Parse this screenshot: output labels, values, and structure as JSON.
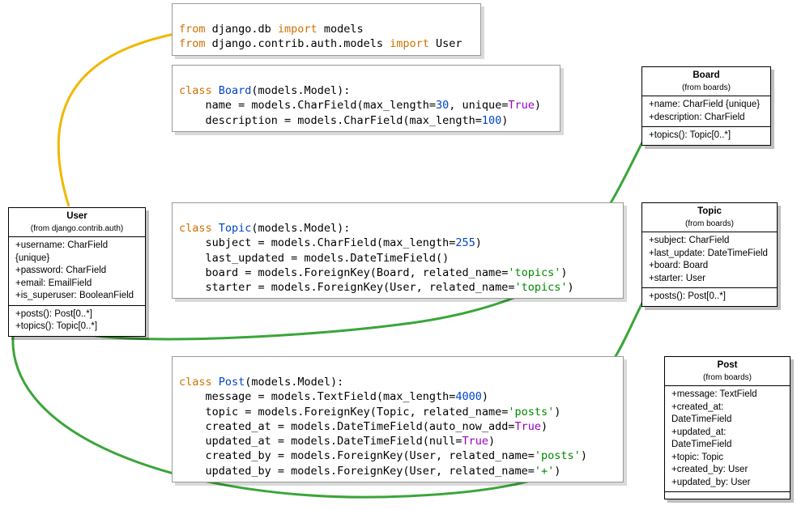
{
  "imports": {
    "line1": "from django.db import models",
    "line2": "from django.contrib.auth.models import User"
  },
  "code_board": {
    "line1": "class Board(models.Model):",
    "line2": "    name = models.CharField(max_length=30, unique=True)",
    "line3": "    description = models.CharField(max_length=100)"
  },
  "code_topic": {
    "line1": "class Topic(models.Model):",
    "line2": "    subject = models.CharField(max_length=255)",
    "line3": "    last_updated = models.DateTimeField()",
    "line4": "    board = models.ForeignKey(Board, related_name='topics')",
    "line5": "    starter = models.ForeignKey(User, related_name='topics')"
  },
  "code_post": {
    "line1": "class Post(models.Model):",
    "line2": "    message = models.TextField(max_length=4000)",
    "line3": "    topic = models.ForeignKey(Topic, related_name='posts')",
    "line4": "    created_at = models.DateTimeField(auto_now_add=True)",
    "line5": "    updated_at = models.DateTimeField(null=True)",
    "line6": "    created_by = models.ForeignKey(User, related_name='posts')",
    "line7": "    updated_by = models.ForeignKey(User, related_name='+')"
  },
  "uml_user": {
    "title": "User",
    "from": "(from django.contrib.auth)",
    "attrs": {
      "a1": "+username: CharField {unique}",
      "a2": "+password: CharField",
      "a3": "+email: EmailField",
      "a4": "+is_superuser: BooleanField"
    },
    "ops": {
      "o1": "+posts(): Post[0..*]",
      "o2": "+topics(): Topic[0..*]"
    }
  },
  "uml_board": {
    "title": "Board",
    "from": "(from boards)",
    "attrs": {
      "a1": "+name: CharField {unique}",
      "a2": "+description: CharField"
    },
    "ops": {
      "o1": "+topics(): Topic[0..*]"
    }
  },
  "uml_topic": {
    "title": "Topic",
    "from": "(from boards)",
    "attrs": {
      "a1": "+subject: CharField",
      "a2": "+last_update: DateTimeField",
      "a3": "+board: Board",
      "a4": "+starter: User"
    },
    "ops": {
      "o1": "+posts(): Post[0..*]"
    }
  },
  "uml_post": {
    "title": "Post",
    "from": "(from boards)",
    "attrs": {
      "a1": "+message: TextField",
      "a2": "+created_at: DateTimeField",
      "a3": "+updated_at: DateTimeField",
      "a4": "+topic: Topic",
      "a5": "+created_by: User",
      "a6": "+updated_by: User"
    }
  }
}
